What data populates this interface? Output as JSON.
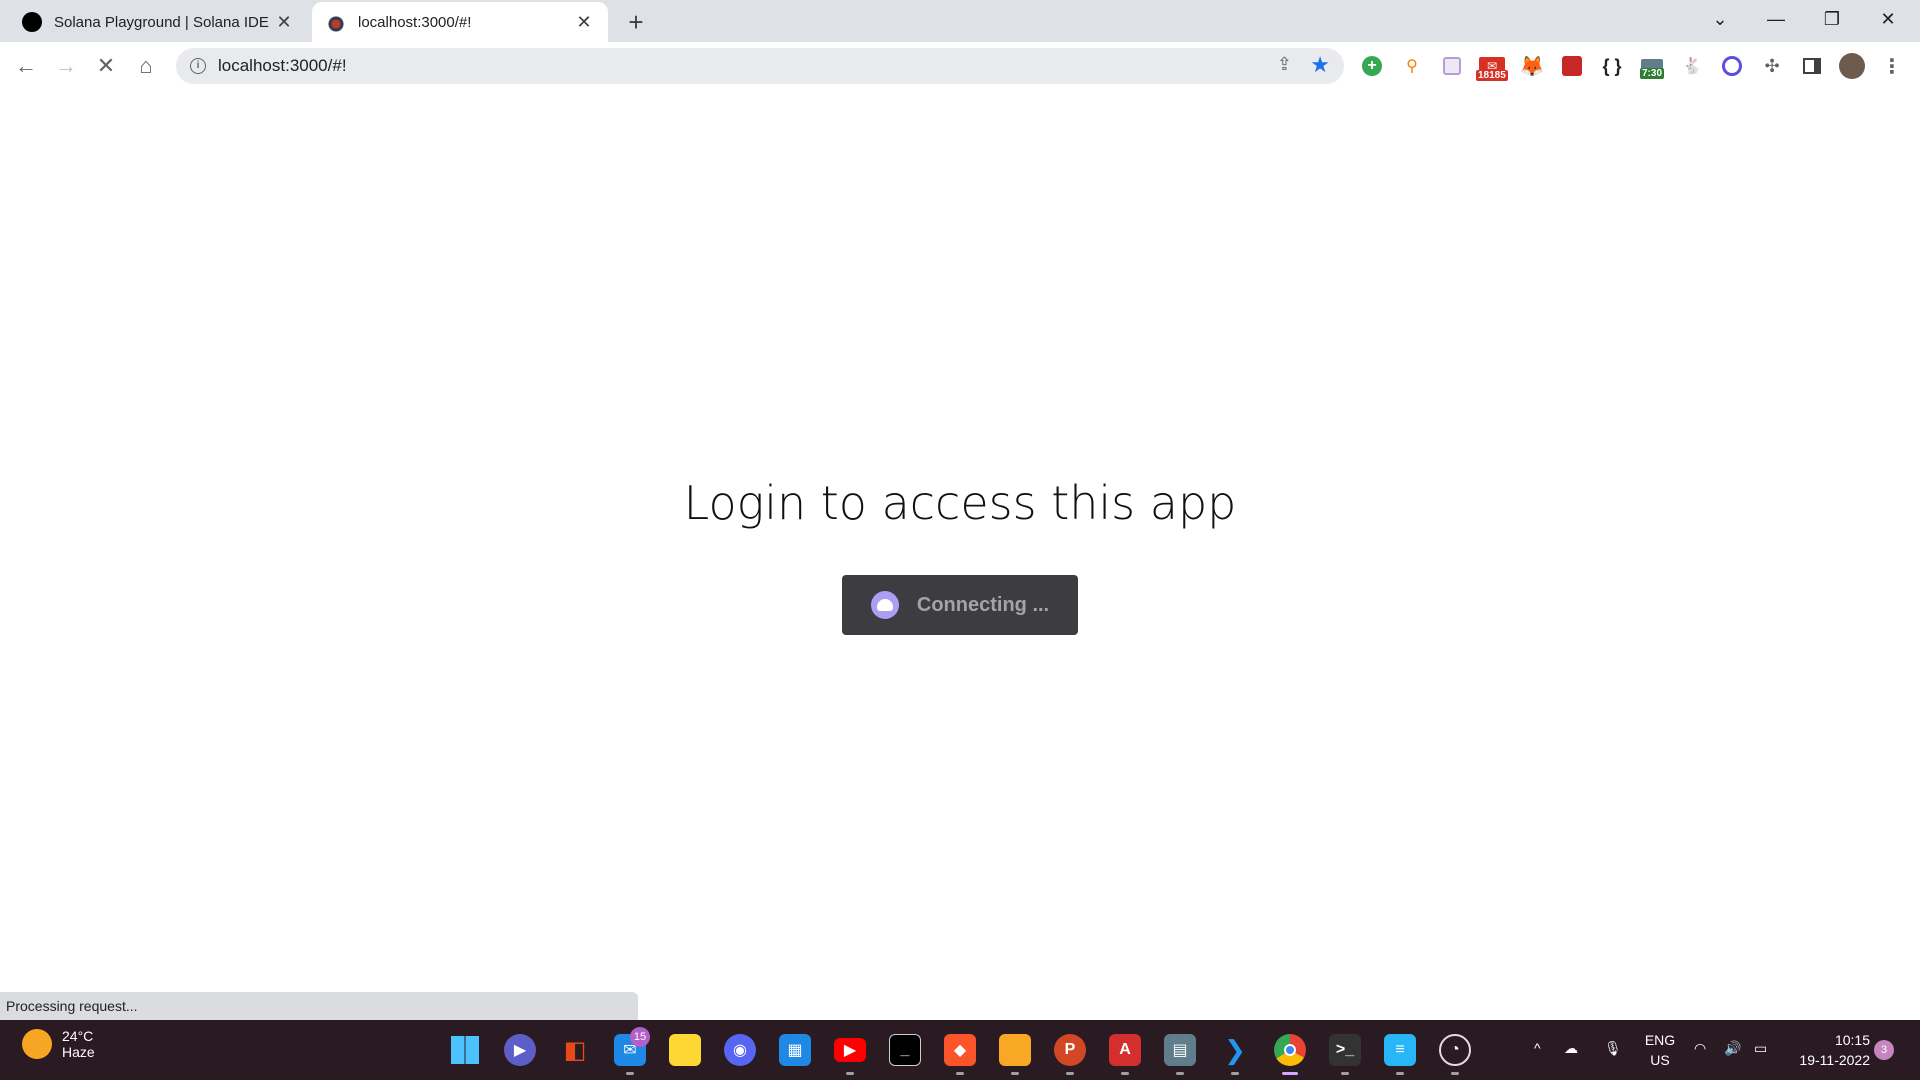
{
  "browser": {
    "tabs": [
      {
        "title": "Solana Playground | Solana IDE",
        "active": false,
        "favicon": "solana-playground-icon"
      },
      {
        "title": "localhost:3000/#!",
        "active": true,
        "favicon": "app-icon"
      }
    ],
    "url": "localhost:3000/#!",
    "extensions": {
      "mail_badge": "18185",
      "clock_badge": "7:30"
    }
  },
  "page": {
    "heading": "Login to access this app",
    "connect_button_label": "Connecting ...",
    "status_text": "Processing request..."
  },
  "taskbar": {
    "weather": {
      "temp": "24°C",
      "condition": "Haze"
    },
    "mail_count": "15",
    "language": {
      "line1": "ENG",
      "line2": "US"
    },
    "clock": {
      "time": "10:15",
      "date": "19-11-2022"
    },
    "notification_count": "3"
  },
  "colors": {
    "button_bg": "#3d3d41",
    "button_text": "#a3a3aa",
    "phantom_purple": "#ab9ff2",
    "taskbar_bg": "#2a1a22"
  }
}
